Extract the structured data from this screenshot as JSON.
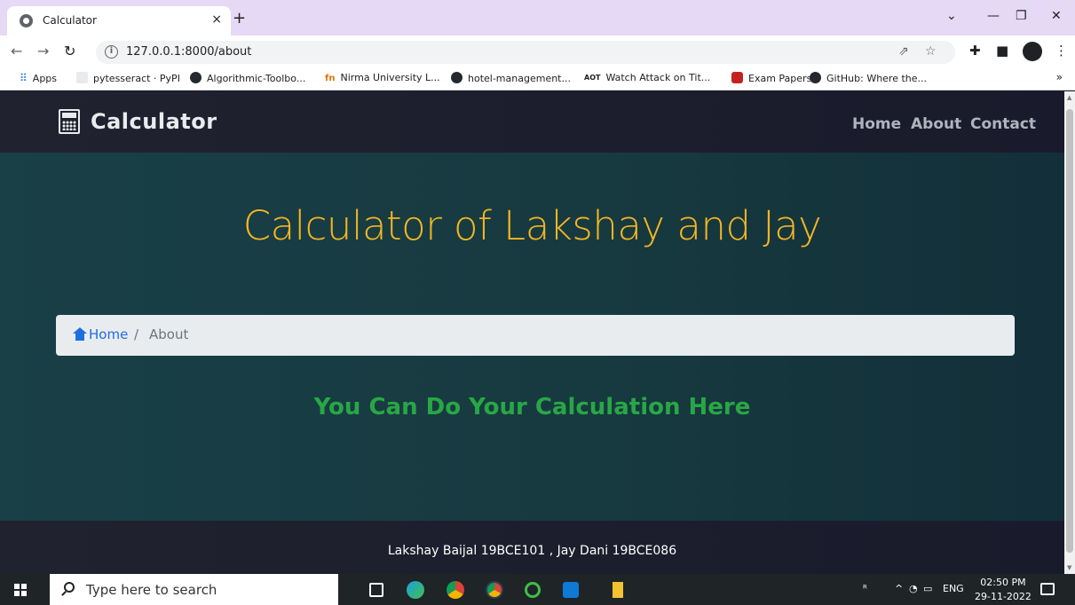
{
  "browser": {
    "tab_title": "Calculator",
    "tab_close": "×",
    "new_tab": "+",
    "url": "127.0.0.1:8000/about",
    "window_controls": {
      "dropdown": "⌄",
      "minimize": "—",
      "restore": "❐",
      "close": "✕"
    }
  },
  "bookmarks": {
    "apps": "Apps",
    "items": [
      "pytesseract · PyPI",
      "Algorithmic-Toolbo...",
      "Nirma University L...",
      "hotel-management...",
      "Watch Attack on Tit...",
      "Exam Papers",
      "GitHub: Where the..."
    ],
    "more": "»"
  },
  "site": {
    "brand": "Calculator",
    "nav": [
      "Home",
      "About",
      "Contact"
    ],
    "hero_title": "Calculator of Lakshay and Jay",
    "breadcrumb": {
      "home": "Home",
      "separator": "/",
      "current": "About"
    },
    "tagline": "You Can Do Your Calculation Here",
    "footer": "Lakshay Baijal 19BCE101 , Jay Dani 19BCE086"
  },
  "taskbar": {
    "search_placeholder": "Type here to search",
    "language": "ENG",
    "time": "02:50 PM",
    "date": "29-11-2022"
  },
  "colors": {
    "hero_title": "#f3b622",
    "tagline": "#28a745",
    "breadcrumb_link": "#1d6fe0",
    "nav_link": "#adb5bd"
  }
}
